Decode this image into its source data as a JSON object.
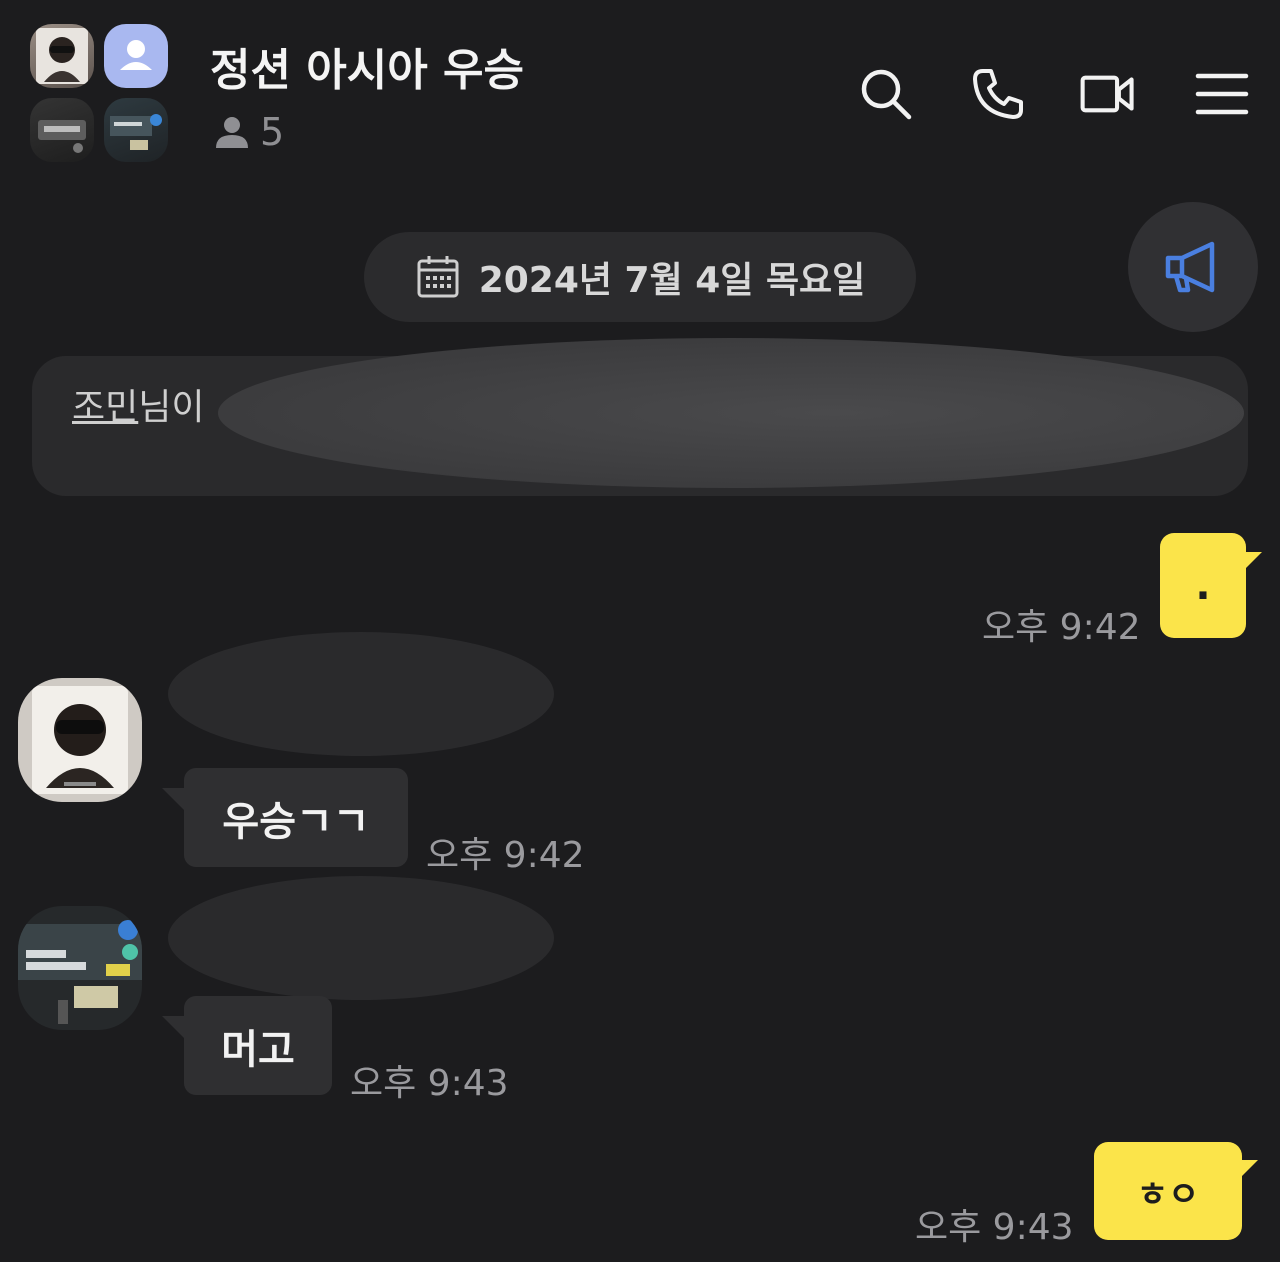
{
  "header": {
    "title": "정션 아시아 우승",
    "member_count": "5"
  },
  "date_divider": {
    "label": "2024년 7월 4일 목요일"
  },
  "notice": {
    "name": "조민",
    "text_prefix": "님이 "
  },
  "messages": [
    {
      "from": "me",
      "text": ".",
      "time": "오후 9:42"
    },
    {
      "from": "user1",
      "text": "우승ㄱㄱ",
      "time": "오후 9:42"
    },
    {
      "from": "user2",
      "text": "머고",
      "time": "오후 9:43"
    },
    {
      "from": "me",
      "text": "ㅎㅇ",
      "time": "오후 9:43"
    }
  ],
  "colors": {
    "background": "#1c1c1e",
    "my_bubble": "#fbe44a",
    "their_bubble": "#2f2f31",
    "announce_icon": "#4a7fe0"
  },
  "icons": [
    "search-icon",
    "phone-icon",
    "video-icon",
    "menu-icon",
    "calendar-icon",
    "megaphone-icon",
    "person-icon"
  ]
}
